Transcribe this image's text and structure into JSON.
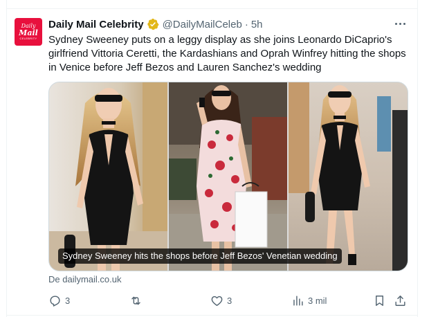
{
  "tweet": {
    "avatar": {
      "line1": "Daily",
      "line2": "Mail",
      "line3": "CELEBRITY"
    },
    "display_name": "Daily Mail Celebrity",
    "handle": "@DailyMailCeleb",
    "separator": "·",
    "time": "5h",
    "text": "Sydney Sweeney puts on a leggy display as she joins Leonardo DiCaprio's girlfriend Vittoria Ceretti, the Kardashians and Oprah Winfrey hitting the shops in Venice before Jeff Bezos and Lauren Sanchez's wedding",
    "media_caption": "Sydney Sweeney hits the shops before Jeff Bezos' Venetian wedding",
    "source": "De dailymail.co.uk"
  },
  "actions": {
    "reply_count": "3",
    "retweet_count": "",
    "like_count": "3",
    "views_count": "3 mil"
  },
  "icons": {
    "verified": "verified-badge-icon",
    "more": "more-dots-icon",
    "reply": "reply-icon",
    "retweet": "retweet-icon",
    "like": "heart-icon",
    "views": "views-bar-chart-icon",
    "bookmark": "bookmark-icon",
    "share": "share-icon"
  },
  "colors": {
    "brand_red": "#e8103d",
    "verified_gold": "#e2b719",
    "text_primary": "#0f1419",
    "text_secondary": "#536471",
    "border": "#cfd9de"
  }
}
